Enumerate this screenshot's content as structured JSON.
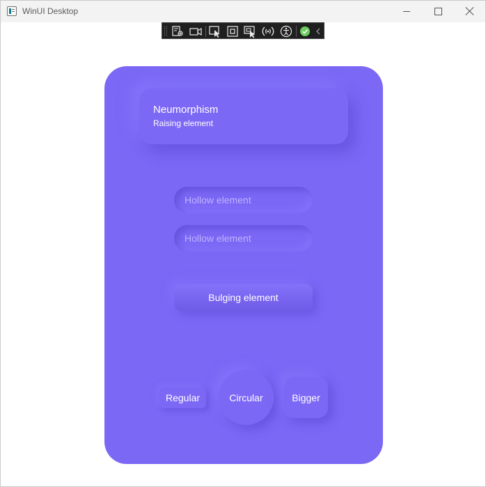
{
  "window": {
    "title": "WinUI Desktop",
    "controls": {
      "minimize_icon": "minimize-icon",
      "maximize_icon": "maximize-icon",
      "close_icon": "close-icon"
    }
  },
  "debug_toolbar": {
    "tools": [
      {
        "icon": "live-visual-tree-icon"
      },
      {
        "icon": "video-camera-icon"
      },
      {
        "icon": "select-element-icon"
      },
      {
        "icon": "display-layout-adorners-icon"
      },
      {
        "icon": "track-focused-element-icon"
      },
      {
        "icon": "hot-reload-icon"
      },
      {
        "icon": "accessibility-icon"
      },
      {
        "icon": "check-status-icon"
      },
      {
        "icon": "collapse-chevron-icon"
      }
    ]
  },
  "colors": {
    "card_background": "#7b68f5",
    "shadow_dark": "#5342cb",
    "shadow_light": "#8c7dff",
    "placeholder_text": "#bdb2ff",
    "text": "#ffffff"
  },
  "card": {
    "raised": {
      "title": "Neumorphism",
      "subtitle": "Raising element"
    },
    "hollow_inputs": [
      {
        "placeholder": "Hollow element",
        "value": ""
      },
      {
        "placeholder": "Hollow element",
        "value": ""
      }
    ],
    "bulging_button": {
      "label": "Bulging element"
    },
    "buttons": {
      "regular": "Regular",
      "circular": "Circular",
      "bigger": "Bigger"
    }
  }
}
